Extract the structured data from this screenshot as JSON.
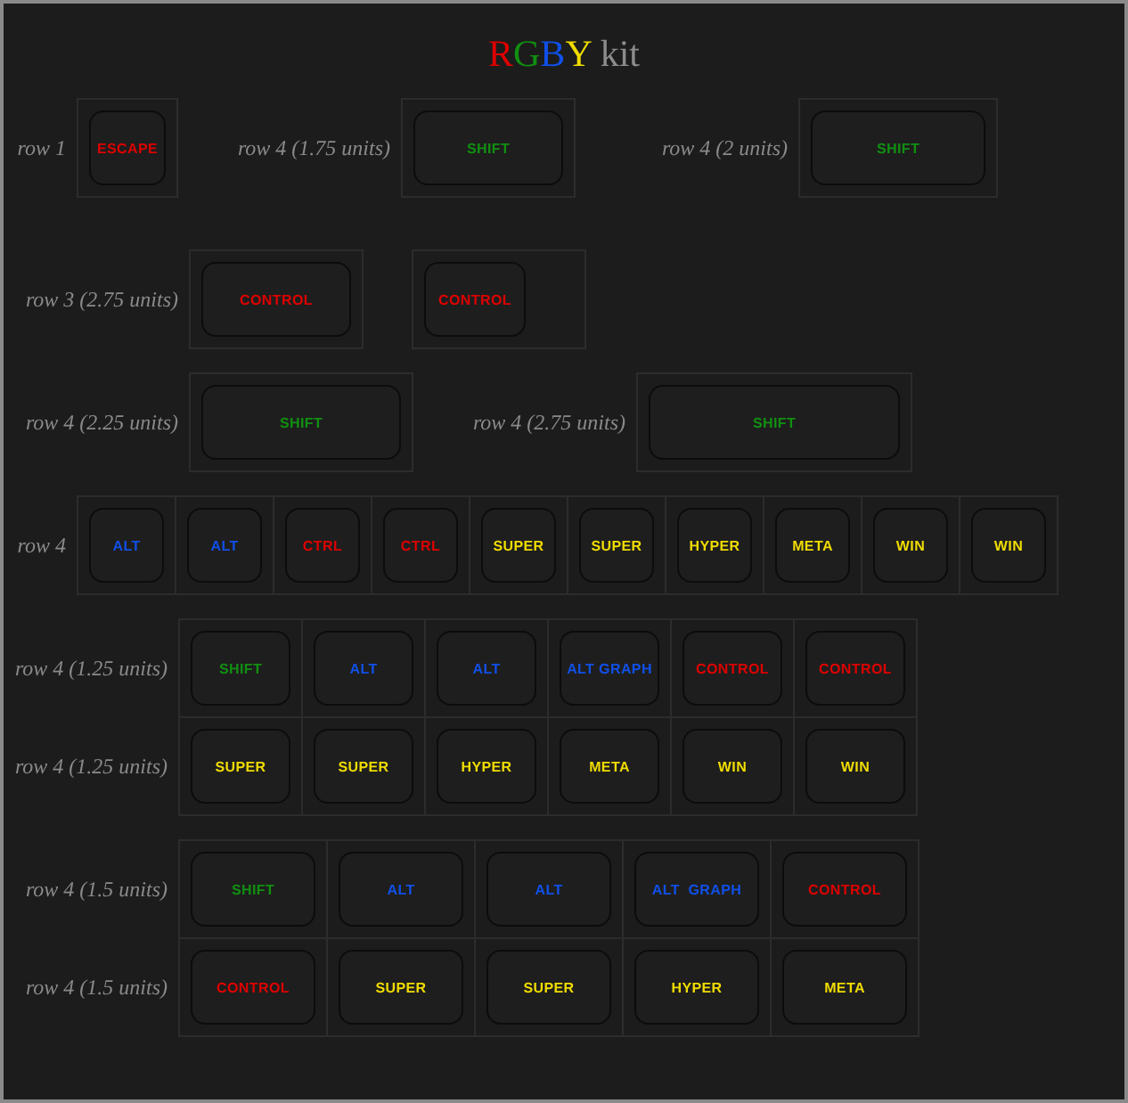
{
  "title": {
    "letters": [
      {
        "text": "R",
        "color": "#dd0000"
      },
      {
        "text": "G",
        "color": "#119011"
      },
      {
        "text": "B",
        "color": "#1050e8"
      },
      {
        "text": "Y",
        "color": "#f0dc00"
      }
    ],
    "text": "kit"
  },
  "sections": [
    {
      "kind": "inline",
      "segments": [
        {
          "label": "row 1",
          "keys": [
            {
              "label": "ESCAPE",
              "color": "#dd0000"
            }
          ]
        },
        {
          "label": "row 4 (1.75 units)",
          "keys": [
            {
              "label": "SHIFT",
              "color": "#119011"
            }
          ]
        },
        {
          "label": "row 4 (2 units)",
          "keys": [
            {
              "label": "SHIFT",
              "color": "#119011"
            }
          ]
        }
      ]
    },
    {
      "kind": "inline",
      "segments": [
        {
          "label": "row 3 (2.75 units)",
          "keys": [
            {
              "label": "CONTROL",
              "color": "#dd0000"
            }
          ]
        },
        {
          "keys": [
            {
              "label": "CONTROL",
              "color": "#dd0000"
            }
          ]
        }
      ]
    },
    {
      "kind": "inline",
      "segments": [
        {
          "label": "row 4 (2.25 units)",
          "keys": [
            {
              "label": "SHIFT",
              "color": "#119011"
            }
          ]
        },
        {
          "label": "row 4 (2.75 units)",
          "keys": [
            {
              "label": "SHIFT",
              "color": "#119011"
            }
          ]
        }
      ]
    },
    {
      "kind": "inline",
      "segments": [
        {
          "label": "row 4",
          "keys": [
            {
              "label": "ALT",
              "color": "#1050e8"
            },
            {
              "label": "ALT",
              "color": "#1050e8"
            },
            {
              "label": "CTRL",
              "color": "#dd0000"
            },
            {
              "label": "CTRL",
              "color": "#dd0000"
            },
            {
              "label": "SUPER",
              "color": "#f0dc00"
            },
            {
              "label": "SUPER",
              "color": "#f0dc00"
            },
            {
              "label": "HYPER",
              "color": "#f0dc00"
            },
            {
              "label": "META",
              "color": "#f0dc00"
            },
            {
              "label": "WIN",
              "color": "#f0dc00"
            },
            {
              "label": "WIN",
              "color": "#f0dc00"
            }
          ]
        }
      ]
    },
    {
      "kind": "grid",
      "rows": [
        {
          "label": "row 4 (1.25 units)",
          "keys": [
            {
              "label": "SHIFT",
              "color": "#119011"
            },
            {
              "label": "ALT",
              "color": "#1050e8"
            },
            {
              "label": "ALT",
              "color": "#1050e8"
            },
            {
              "label": "ALT GRAPH",
              "color": "#1050e8"
            },
            {
              "label": "CONTROL",
              "color": "#dd0000"
            },
            {
              "label": "CONTROL",
              "color": "#dd0000"
            }
          ]
        },
        {
          "label": "row 4 (1.25 units)",
          "keys": [
            {
              "label": "SUPER",
              "color": "#f0dc00"
            },
            {
              "label": "SUPER",
              "color": "#f0dc00"
            },
            {
              "label": "HYPER",
              "color": "#f0dc00"
            },
            {
              "label": "META",
              "color": "#f0dc00"
            },
            {
              "label": "WIN",
              "color": "#f0dc00"
            },
            {
              "label": "WIN",
              "color": "#f0dc00"
            }
          ]
        }
      ]
    },
    {
      "kind": "grid",
      "rows": [
        {
          "label": "row 4 (1.5 units)",
          "keys": [
            {
              "label": "SHIFT",
              "color": "#119011"
            },
            {
              "label": "ALT",
              "color": "#1050e8"
            },
            {
              "label": "ALT",
              "color": "#1050e8"
            },
            {
              "label": "ALT  GRAPH",
              "color": "#1050e8"
            },
            {
              "label": "CONTROL",
              "color": "#dd0000"
            }
          ]
        },
        {
          "label": "row 4 (1.5 units)",
          "keys": [
            {
              "label": "CONTROL",
              "color": "#dd0000"
            },
            {
              "label": "SUPER",
              "color": "#f0dc00"
            },
            {
              "label": "SUPER",
              "color": "#f0dc00"
            },
            {
              "label": "HYPER",
              "color": "#f0dc00"
            },
            {
              "label": "META",
              "color": "#f0dc00"
            }
          ]
        }
      ]
    }
  ]
}
